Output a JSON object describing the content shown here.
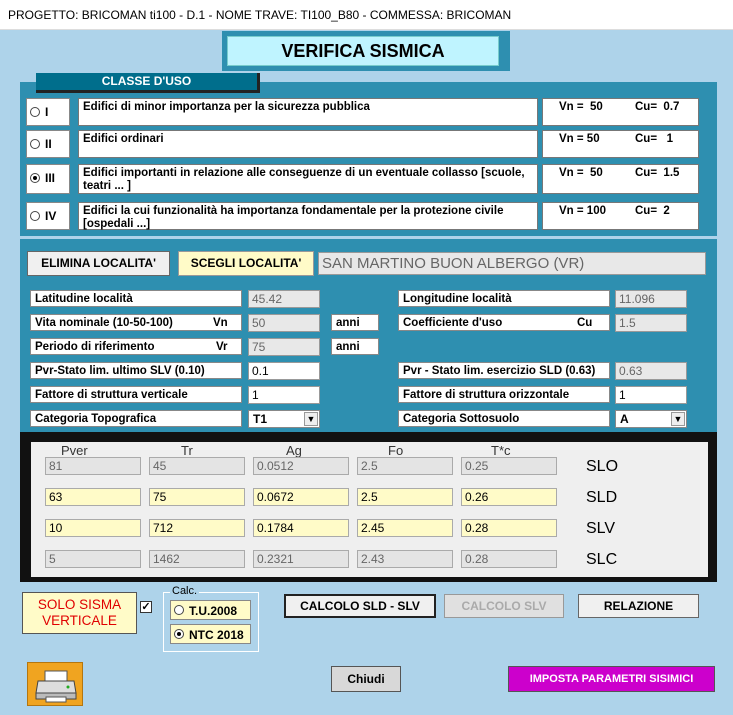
{
  "window_title": "PROGETTO: BRICOMAN ti100 - D.1 - NOME TRAVE: TI100_B80 - COMMESSA: BRICOMAN",
  "heading": "VERIFICA SISMICA",
  "classe_uso": {
    "title": "CLASSE D'USO",
    "rows": [
      {
        "roman": "I",
        "selected": false,
        "desc": "Edifici di minor importanza per la sicurezza pubblica",
        "vn": "Vn =  50",
        "cu": "Cu=  0.7"
      },
      {
        "roman": "II",
        "selected": false,
        "desc": "Edifici ordinari",
        "vn": "Vn = 50",
        "cu": "Cu=   1"
      },
      {
        "roman": "III",
        "selected": true,
        "desc": "Edifici importanti in relazione alle conseguenze di un eventuale collasso [scuole, teatri ... ]",
        "vn": "Vn =  50",
        "cu": "Cu=  1.5"
      },
      {
        "roman": "IV",
        "selected": false,
        "desc": "Edifici la cui funzionalità ha importanza fondamentale per la protezione civile [ospedali ...]",
        "vn": "Vn = 100",
        "cu": "Cu=  2"
      }
    ]
  },
  "localita": {
    "elimina_label": "ELIMINA LOCALITA'",
    "scegli_label": "SCEGLI LOCALITA'",
    "name": "SAN MARTINO BUON ALBERGO (VR)"
  },
  "params": {
    "latitudine_label": "Latitudine località",
    "latitudine": "45.42",
    "longitudine_label": "Longitudine località",
    "longitudine": "11.096",
    "vita_label": "Vita nominale (10-50-100)",
    "vita_sym": "Vn",
    "vita": "50",
    "anni": "anni",
    "coeff_label": "Coefficiente d'uso",
    "coeff_sym": "Cu",
    "coeff": "1.5",
    "periodo_label": "Periodo di riferimento",
    "periodo_sym": "Vr",
    "periodo": "75",
    "pvr_slv_label": "Pvr-Stato lim. ultimo SLV (0.10)",
    "pvr_slv": "0.1",
    "pvr_sld_label": "Pvr - Stato lim. esercizio SLD (0.63)",
    "pvr_sld": "0.63",
    "fatt_vert_label": "Fattore di struttura verticale",
    "fatt_vert": "1",
    "fatt_oriz_label": "Fattore di struttura orizzontale",
    "fatt_oriz": "1",
    "cat_topo_label": "Categoria Topografica",
    "cat_topo": "T1",
    "cat_sotto_label": "Categoria Sottosuolo",
    "cat_sotto": "A"
  },
  "grid": {
    "headers": [
      "Pver",
      "Tr",
      "Ag",
      "Fo",
      "T*c"
    ],
    "rows": [
      {
        "label": "SLO",
        "style": "gray",
        "values": [
          "81",
          "45",
          "0.0512",
          "2.5",
          "0.25"
        ]
      },
      {
        "label": "SLD",
        "style": "yel",
        "values": [
          "63",
          "75",
          "0.0672",
          "2.5",
          "0.26"
        ]
      },
      {
        "label": "SLV",
        "style": "yel",
        "values": [
          "10",
          "712",
          "0.1784",
          "2.45",
          "0.28"
        ]
      },
      {
        "label": "SLC",
        "style": "gray",
        "values": [
          "5",
          "1462",
          "0.2321",
          "2.43",
          "0.28"
        ]
      }
    ]
  },
  "bottom": {
    "solo_sisma": "SOLO SISMA VERTICALE",
    "solo_line1": "SOLO SISMA",
    "solo_line2": "VERTICALE",
    "calc_legend": "Calc.",
    "tu2008": "T.U.2008",
    "ntc2018": "NTC 2018",
    "calcolo_sld_slv": "CALCOLO SLD - SLV",
    "calcolo_slv": "CALCOLO  SLV",
    "relazione": "RELAZIONE",
    "chiudi": "Chiudi",
    "imposta": "IMPOSTA PARAMETRI SISIMICI"
  },
  "colors": {
    "client_bg": "#aed3ea",
    "panel_bg": "#2e8fb0",
    "heading_bg": "#bff4ff",
    "yellow_field": "#fffbc8",
    "imposta_bg": "#cc00cc"
  }
}
